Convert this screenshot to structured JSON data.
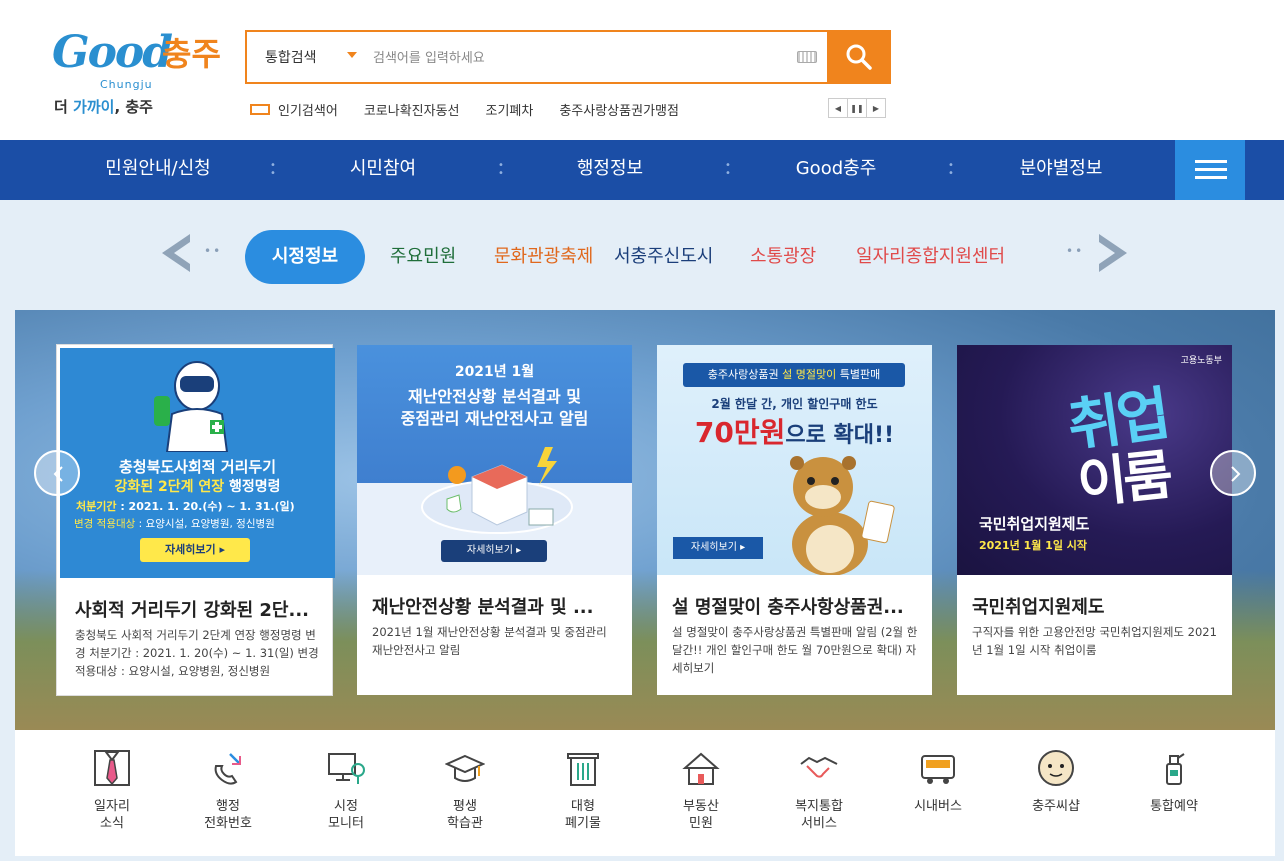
{
  "header": {
    "logo": {
      "good": "Good",
      "city": "충주",
      "sub": "Chungju",
      "slogan_a": "더 ",
      "slogan_hl": "가까이",
      "slogan_b": ", 충주"
    },
    "search": {
      "select_label": "통합검색",
      "placeholder": "검색어를 입력하세요"
    },
    "popular": {
      "label": "인기검색어",
      "items": [
        "코로나확진자동선",
        "조기폐차",
        "충주사랑상품권가맹점"
      ]
    }
  },
  "nav": {
    "items": [
      "민원안내/신청",
      "시민참여",
      "행정정보",
      "Good충주",
      "분야별정보"
    ]
  },
  "categories": {
    "tabs": [
      {
        "label": "시정정보",
        "color": "#ffffff"
      },
      {
        "label": "주요민원",
        "color": "#1f6e3a"
      },
      {
        "label": "문화관광축제",
        "color": "#e0681d"
      },
      {
        "label": "서충주신도시",
        "color": "#1b3e7a"
      },
      {
        "label": "소통광장",
        "color": "#e04a4a"
      },
      {
        "label": "일자리종합지원센터",
        "color": "#e04a4a"
      }
    ]
  },
  "cards": [
    {
      "title": "사회적 거리두기 강화된 2단...",
      "desc": "충청북도 사회적 거리두기 2단계 연장 행정명령 변경 처분기간 : 2021. 1. 20(수) ~ 1. 31(일) 변경 적용대상 : 요양시설, 요양병원, 정신병원",
      "art": {
        "line1": "충청북도사회적 거리두기",
        "line2_y": "강화된 2단계 연장",
        "line2_w": " 행정명령",
        "line3_label": "처분기간",
        "line3_value": ": 2021. 1. 20.(수) ~ 1. 31.(일)",
        "line4_label": "변경 적용대상",
        "line4_value": ": 요양시설, 요양병원, 정신병원",
        "more": "자세히보기 ▸"
      }
    },
    {
      "title": "재난안전상황 분석결과 및 ...",
      "desc": "2021년 1월 재난안전상황 분석결과 및 중점관리 재난안전사고 알림",
      "art": {
        "l1": "2021년 1월",
        "l2": "재난안전상황 분석결과 및",
        "l3": "중점관리 재난안전사고 알림",
        "more": "자세히보기 ▸"
      }
    },
    {
      "title": "설 명절맞이 충주사항상품권...",
      "desc": "설 명절맞이 충주사랑상품권 특별판매 알림 (2월 한달간!! 개인 할인구매 한도 월 70만원으로 확대) 자세히보기",
      "art": {
        "hdr_a": "충주사랑상품권 ",
        "hdr_y": "설 명절맞이",
        "hdr_b": " 특별판매",
        "sub": "2월 한달 간, 개인 할인구매 한도",
        "big": "70만원",
        "big_b": "으로 확대!!",
        "more": "자세히보기 ▸"
      }
    },
    {
      "title": "국민취업지원제도",
      "desc": "구직자를 위한 고용안전망 국민취업지원제도 2021년 1월 1일 시작 취업이룸",
      "art": {
        "gov": "고용노동부",
        "big1": "취업",
        "big2": "이룸",
        "t1": "국민취업지원제도",
        "t2": "2021년 1월 1일 시작"
      }
    }
  ],
  "quick_menu": [
    {
      "label": "일자리\n소식",
      "icon": "necktie-icon"
    },
    {
      "label": "행정\n전화번호",
      "icon": "phone-icon"
    },
    {
      "label": "시정\n모니터",
      "icon": "monitor-icon"
    },
    {
      "label": "평생\n학습관",
      "icon": "graduation-cap-icon"
    },
    {
      "label": "대형\n폐기물",
      "icon": "trash-can-icon"
    },
    {
      "label": "부동산\n민원",
      "icon": "house-icon"
    },
    {
      "label": "복지통합\n서비스",
      "icon": "handshake-icon"
    },
    {
      "label": "시내버스",
      "icon": "bus-icon"
    },
    {
      "label": "충주씨샵",
      "icon": "mascot-icon"
    },
    {
      "label": "통합예약",
      "icon": "spray-bottle-icon"
    }
  ],
  "colors": {
    "accent": "#f0841d",
    "nav_bg": "#1b4ea6",
    "active_tab": "#2b8de0"
  }
}
